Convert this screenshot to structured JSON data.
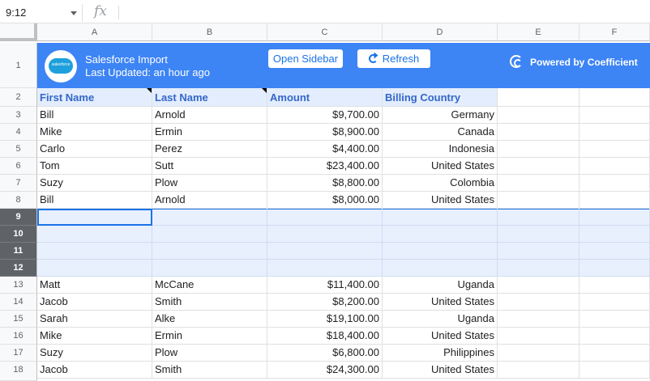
{
  "formula_bar": {
    "name_box": "9:12",
    "fx_label": "fx"
  },
  "columns": [
    "A",
    "B",
    "C",
    "D",
    "E",
    "F"
  ],
  "row_numbers": [
    "1",
    "2",
    "3",
    "4",
    "5",
    "6",
    "7",
    "8",
    "9",
    "10",
    "11",
    "12",
    "13",
    "14",
    "15",
    "16",
    "17",
    "18"
  ],
  "banner": {
    "logo_text": "salesforce",
    "title": "Salesforce Import",
    "subtitle": "Last Updated: an hour ago",
    "open_sidebar_label": "Open Sidebar",
    "refresh_label": "Refresh",
    "powered_by": "Powered by Coefficient",
    "color": "#3d84f5"
  },
  "table": {
    "headers": [
      "First Name",
      "Last Name",
      "Amount",
      "Billing Country"
    ],
    "rows_before": [
      [
        "Bill",
        "Arnold",
        "$9,700.00",
        "Germany"
      ],
      [
        "Mike",
        "Ermin",
        "$8,900.00",
        "Canada"
      ],
      [
        "Carlo",
        "Perez",
        "$4,400.00",
        "Indonesia"
      ],
      [
        "Tom",
        "Sutt",
        "$23,400.00",
        "United States"
      ],
      [
        "Suzy",
        "Plow",
        "$8,800.00",
        "Colombia"
      ],
      [
        "Bill",
        "Arnold",
        "$8,000.00",
        "United States"
      ]
    ],
    "rows_after": [
      [
        "Matt",
        "McCane",
        "$11,400.00",
        "Uganda"
      ],
      [
        "Jacob",
        "Smith",
        "$8,200.00",
        "United States"
      ],
      [
        "Sarah",
        "Alke",
        "$19,100.00",
        "Uganda"
      ],
      [
        "Mike",
        "Ermin",
        "$18,400.00",
        "United States"
      ],
      [
        "Suzy",
        "Plow",
        "$6,800.00",
        "Philippines"
      ],
      [
        "Jacob",
        "Smith",
        "$24,300.00",
        "United States"
      ]
    ]
  },
  "selection": {
    "selected_rows": [
      "9",
      "10",
      "11",
      "12"
    ],
    "accent": "#1a73e8"
  }
}
